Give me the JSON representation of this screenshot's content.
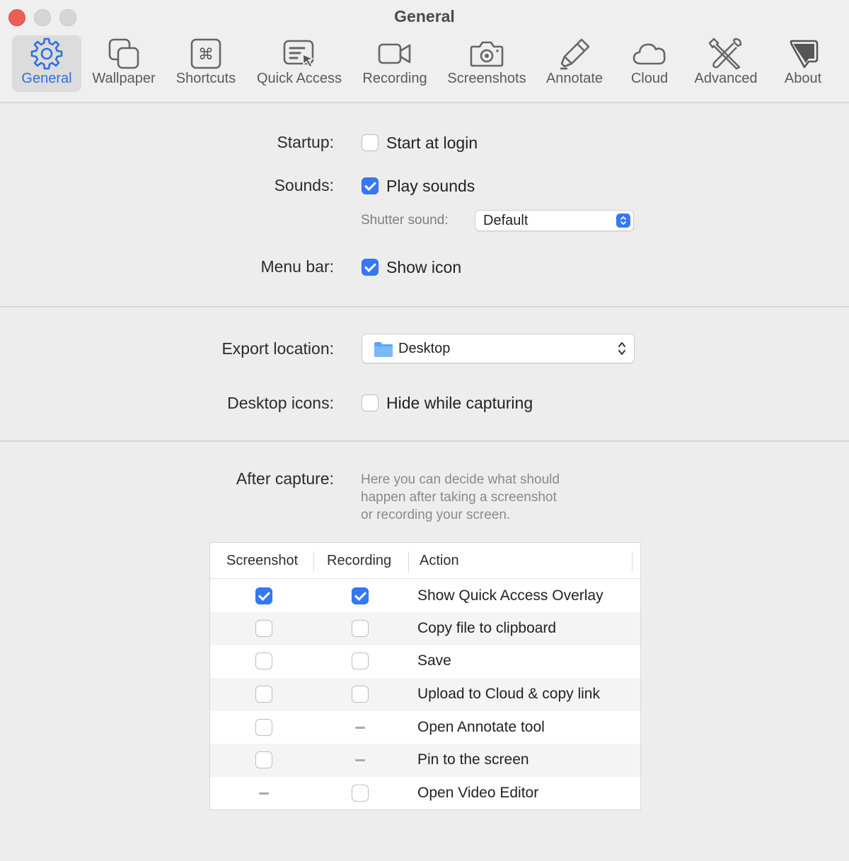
{
  "window": {
    "title": "General"
  },
  "tabs": [
    {
      "label": "General",
      "icon": "gear-icon",
      "selected": true
    },
    {
      "label": "Wallpaper",
      "icon": "wallpaper-icon"
    },
    {
      "label": "Shortcuts",
      "icon": "command-key-icon"
    },
    {
      "label": "Quick Access",
      "icon": "quick-access-icon"
    },
    {
      "label": "Recording",
      "icon": "video-camera-icon"
    },
    {
      "label": "Screenshots",
      "icon": "camera-icon"
    },
    {
      "label": "Annotate",
      "icon": "highlighter-icon"
    },
    {
      "label": "Cloud",
      "icon": "cloud-icon"
    },
    {
      "label": "Advanced",
      "icon": "tools-icon"
    },
    {
      "label": "About",
      "icon": "about-icon"
    }
  ],
  "startup": {
    "label": "Startup:",
    "option": "Start at login",
    "checked": false
  },
  "sounds": {
    "label": "Sounds:",
    "option": "Play sounds",
    "checked": true,
    "shutter_label": "Shutter sound:",
    "shutter_value": "Default"
  },
  "menubar": {
    "label": "Menu bar:",
    "option": "Show icon",
    "checked": true
  },
  "export": {
    "label": "Export location:",
    "value": "Desktop"
  },
  "desktop_icons": {
    "label": "Desktop icons:",
    "option": "Hide while capturing",
    "checked": false
  },
  "after_capture": {
    "label": "After capture:",
    "help_lines": [
      "Here you can decide what should",
      "happen after taking a screenshot",
      "or recording your screen."
    ],
    "columns": [
      "Screenshot",
      "Recording",
      "Action"
    ],
    "rows": [
      {
        "action": "Show Quick Access Overlay",
        "screenshot": "checked",
        "recording": "checked"
      },
      {
        "action": "Copy file to clipboard",
        "screenshot": "unchecked",
        "recording": "unchecked"
      },
      {
        "action": "Save",
        "screenshot": "unchecked",
        "recording": "unchecked"
      },
      {
        "action": "Upload to Cloud & copy link",
        "screenshot": "unchecked",
        "recording": "unchecked"
      },
      {
        "action": "Open Annotate tool",
        "screenshot": "unchecked",
        "recording": "na"
      },
      {
        "action": "Pin to the screen",
        "screenshot": "unchecked",
        "recording": "na"
      },
      {
        "action": "Open Video Editor",
        "screenshot": "na",
        "recording": "unchecked"
      }
    ]
  },
  "colors": {
    "accent": "#3478f6",
    "close": "#ec5f57"
  }
}
